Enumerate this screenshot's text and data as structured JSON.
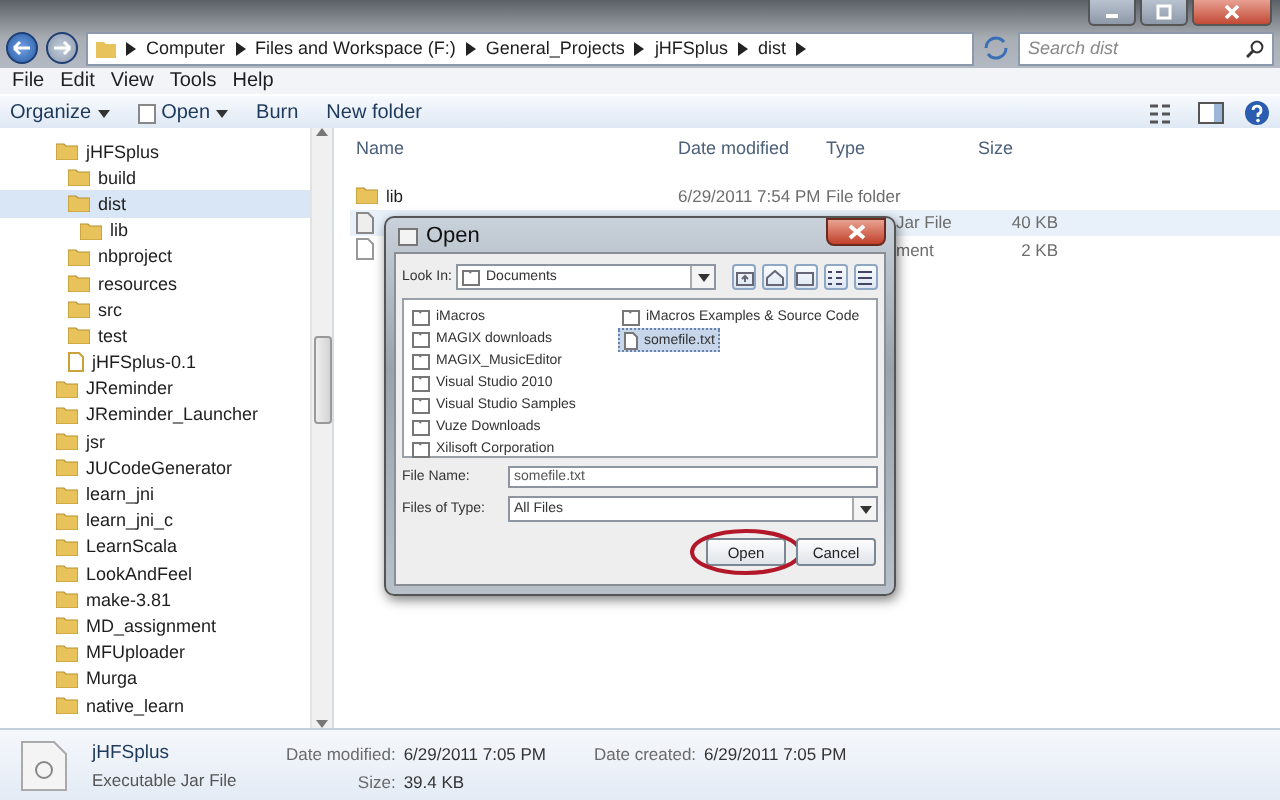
{
  "address_bar": {
    "crumbs": [
      "Computer",
      "Files and Workspace (F:)",
      "General_Projects",
      "jHFSplus",
      "dist"
    ],
    "search_placeholder": "Search dist"
  },
  "menu": [
    "File",
    "Edit",
    "View",
    "Tools",
    "Help"
  ],
  "toolbar": [
    {
      "label": "Organize",
      "kind": "dropdown"
    },
    {
      "label": "Open",
      "kind": "split"
    },
    {
      "label": "Burn",
      "kind": "plain"
    },
    {
      "label": "New folder",
      "kind": "plain"
    }
  ],
  "sidebar": {
    "items": [
      {
        "label": "jHFSplus",
        "kind": "folder",
        "selected": false,
        "children": [
          {
            "label": "build",
            "kind": "folder",
            "selected": false
          },
          {
            "label": "dist",
            "kind": "folder",
            "selected": true,
            "children": [
              {
                "label": "lib",
                "kind": "folder",
                "selected": false
              }
            ]
          },
          {
            "label": "nbproject",
            "kind": "folder",
            "selected": false
          },
          {
            "label": "resources",
            "kind": "folder",
            "selected": false
          },
          {
            "label": "src",
            "kind": "folder",
            "selected": false
          },
          {
            "label": "test",
            "kind": "folder",
            "selected": false
          },
          {
            "label": "jHFSplus-0.1",
            "kind": "file",
            "selected": false
          }
        ]
      },
      {
        "label": "JReminder",
        "kind": "folder",
        "selected": false
      },
      {
        "label": "JReminder_Launcher",
        "kind": "folder",
        "selected": false
      },
      {
        "label": "jsr",
        "kind": "folder",
        "selected": false
      },
      {
        "label": "JUCodeGenerator",
        "kind": "folder",
        "selected": false
      },
      {
        "label": "learn_jni",
        "kind": "folder",
        "selected": false
      },
      {
        "label": "learn_jni_c",
        "kind": "folder",
        "selected": false
      },
      {
        "label": "LearnScala",
        "kind": "folder",
        "selected": false
      },
      {
        "label": "LookAndFeel",
        "kind": "folder",
        "selected": false
      },
      {
        "label": "make-3.81",
        "kind": "folder",
        "selected": false
      },
      {
        "label": "MD_assignment",
        "kind": "folder",
        "selected": false
      },
      {
        "label": "MFUploader",
        "kind": "folder",
        "selected": false
      },
      {
        "label": "Murga",
        "kind": "folder",
        "selected": false
      },
      {
        "label": "native_learn",
        "kind": "folder",
        "selected": false
      }
    ]
  },
  "file_list": {
    "columns": [
      "Name",
      "Date modified",
      "Type",
      "Size"
    ],
    "rows": [
      {
        "kind": "folder",
        "name": "lib",
        "date": "6/29/2011 7:54 PM",
        "type": "File folder",
        "selected": false
      },
      {
        "kind": "jar",
        "type": "Jar File",
        "size": "40 KB",
        "selected": true
      },
      {
        "kind": "doc",
        "type": "ment",
        "size": "2 KB",
        "selected": false
      }
    ]
  },
  "dialog": {
    "title": "Open",
    "look_in_label": "Look In:",
    "look_in": "Documents",
    "files": [
      {
        "name": "iMacros",
        "kind": "folder",
        "selected": false
      },
      {
        "name": "MAGIX downloads",
        "kind": "folder",
        "selected": false
      },
      {
        "name": "MAGIX_MusicEditor",
        "kind": "folder",
        "selected": false
      },
      {
        "name": "Visual Studio 2010",
        "kind": "folder",
        "selected": false
      },
      {
        "name": "Visual Studio Samples",
        "kind": "folder",
        "selected": false
      },
      {
        "name": "Vuze Downloads",
        "kind": "folder",
        "selected": false
      },
      {
        "name": "Xilisoft Corporation",
        "kind": "folder",
        "selected": false
      },
      {
        "name": "iMacros Examples & Source Code",
        "kind": "folder",
        "selected": false
      },
      {
        "name": "somefile.txt",
        "kind": "file",
        "selected": true
      }
    ],
    "file_name_label": "File Name:",
    "file_name": "somefile.txt",
    "type_label": "Files of Type:",
    "type": "All Files",
    "buttons": [
      {
        "label": "Open",
        "circled": true
      },
      {
        "label": "Cancel",
        "circled": false
      }
    ]
  },
  "details": {
    "name": "jHFSplus",
    "type": "Executable Jar File",
    "fields": [
      {
        "label": "Date modified:",
        "value": "6/29/2011 7:05 PM"
      },
      {
        "label": "Date created:",
        "value": "6/29/2011 7:05 PM"
      },
      {
        "label": "Size:",
        "value": "39.4 KB"
      }
    ]
  }
}
